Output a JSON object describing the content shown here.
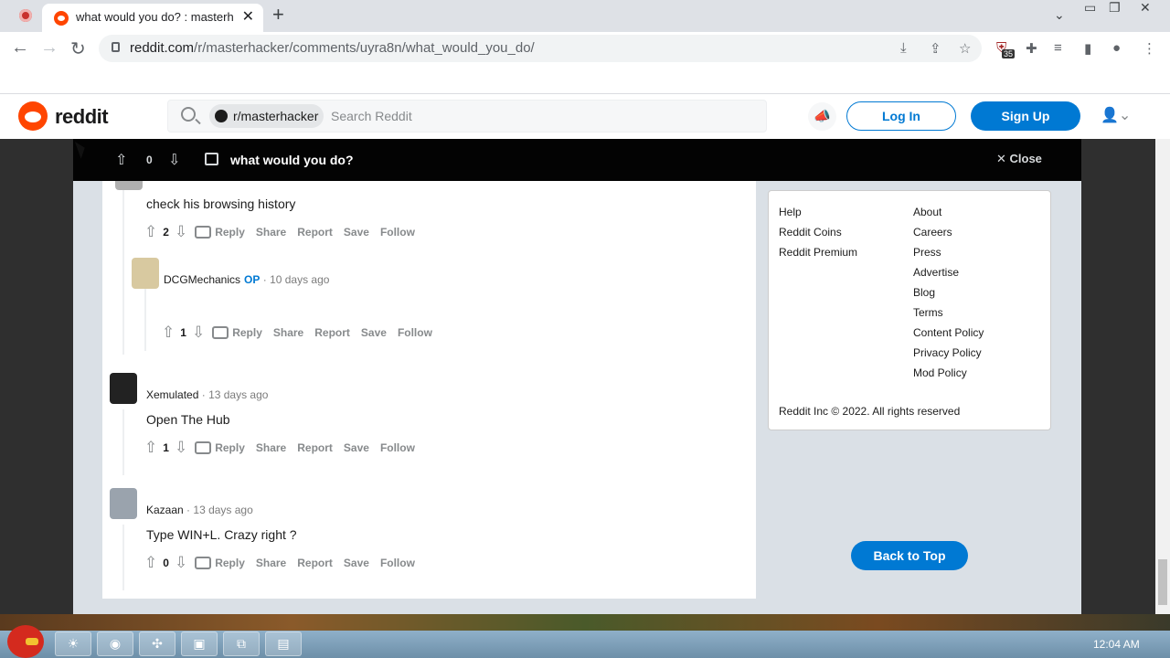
{
  "browser": {
    "tab_title": "what would you do? : masterh",
    "url_host": "reddit.com",
    "url_path": "/r/masterhacker/comments/uyra8n/what_would_you_do/",
    "extension_badge": "35"
  },
  "header": {
    "logo_text": "reddit",
    "subreddit_chip": "r/masterhacker",
    "search_placeholder": "Search Reddit",
    "login_label": "Log In",
    "signup_label": "Sign Up"
  },
  "post_bar": {
    "score": "0",
    "title": "what would you do?",
    "close_label": "Close"
  },
  "comments": [
    {
      "text": "check his browsing history",
      "score": "2"
    },
    {
      "author": "DCGMechanics",
      "op_label": "OP",
      "time": "10 days ago",
      "text": "󠀠󠀠",
      "score": "1"
    },
    {
      "author": "Xemulated",
      "time": "13 days ago",
      "text": "Open The Hub",
      "score": "1"
    },
    {
      "author": "Kazaan",
      "time": "13 days ago",
      "text": "Type WIN+L. Crazy right ?",
      "score": "0"
    }
  ],
  "action_labels": {
    "reply": "Reply",
    "share": "Share",
    "report": "Report",
    "save": "Save",
    "follow": "Follow"
  },
  "footer_links": {
    "left": [
      "Help",
      "Reddit Coins",
      "Reddit Premium"
    ],
    "right": [
      "About",
      "Careers",
      "Press",
      "Advertise",
      "Blog",
      "Terms",
      "Content Policy",
      "Privacy Policy",
      "Mod Policy"
    ],
    "copyright": "Reddit Inc © 2022. All rights reserved"
  },
  "back_to_top_label": "Back to Top",
  "taskbar": {
    "clock": "12:04 AM"
  },
  "colors": {
    "reddit_orange": "#ff4500",
    "reddit_blue": "#0079d3"
  }
}
